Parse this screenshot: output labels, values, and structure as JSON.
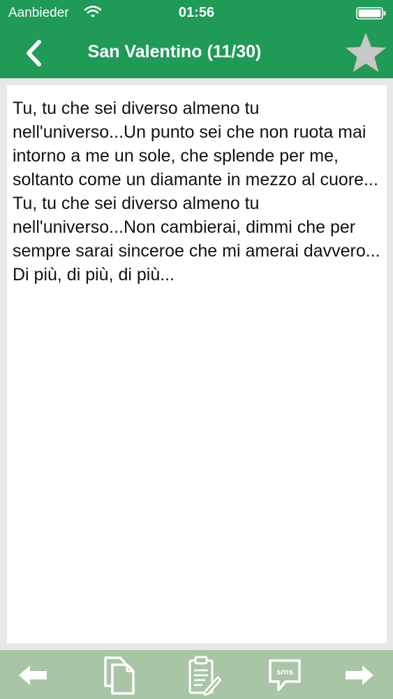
{
  "status_bar": {
    "carrier": "Aanbieder",
    "time": "01:56"
  },
  "navbar": {
    "title": "San Valentino (11/30)",
    "icons": [
      "chevron-left-icon",
      "star-icon"
    ],
    "favorite": false
  },
  "content": {
    "text": "Tu, tu che sei diverso almeno tu nell'universo...Un punto sei che non ruota mai intorno a me un sole, che splende per me, soltanto come un diamante in mezzo al cuore... Tu, tu che sei diverso almeno tu nell'universo...Non cambierai, dimmi che per sempre sarai sinceroe che mi amerai davvero... Di più, di più, di più..."
  },
  "toolbar": {
    "sms_label": "sms",
    "icons": [
      "arrow-left-icon",
      "copy-icon",
      "clipboard-edit-icon",
      "sms-icon",
      "arrow-right-icon"
    ]
  },
  "colors": {
    "header_green": "#1f9a57",
    "toolbar_green": "#a8c5a6",
    "background_gray": "#e8e8e8",
    "star_gray": "#c8c8c8"
  }
}
